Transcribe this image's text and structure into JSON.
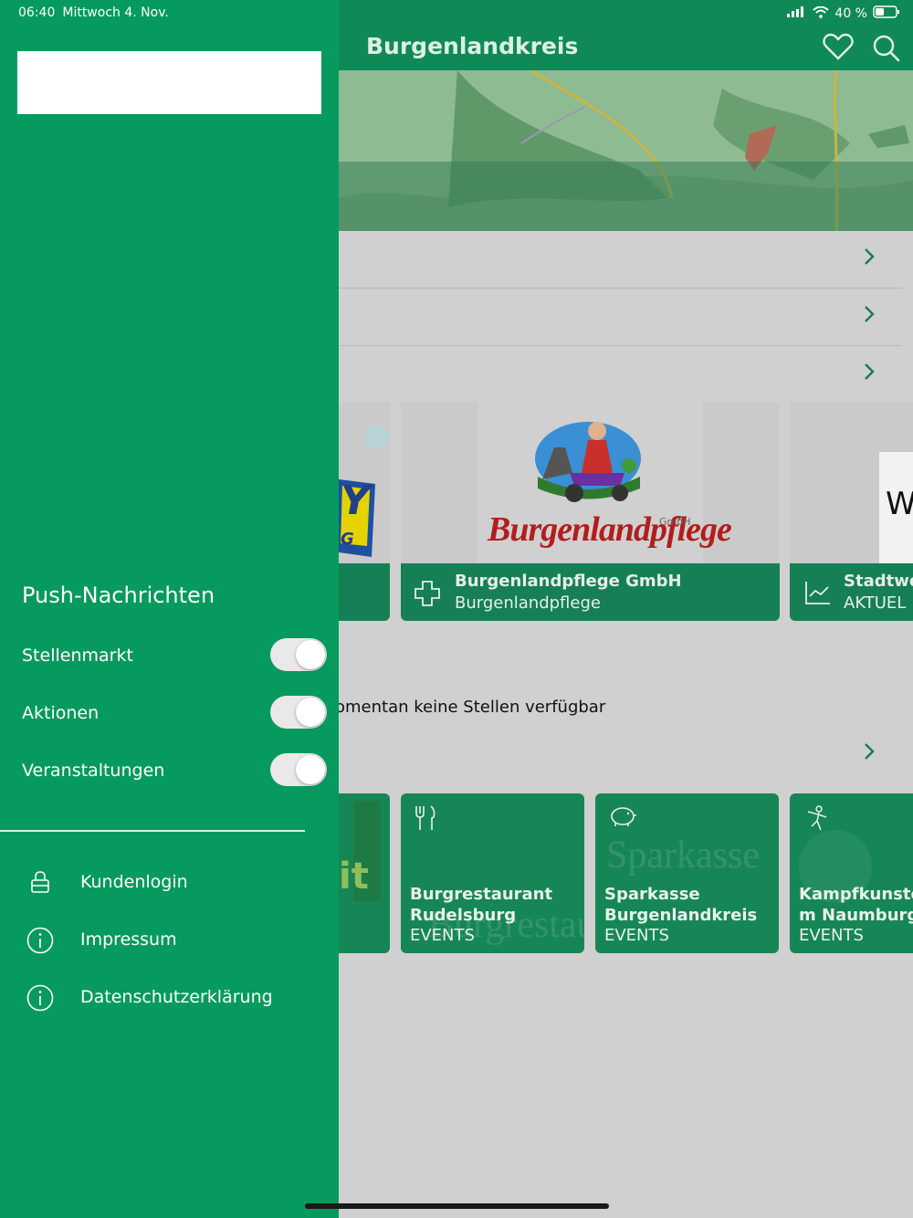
{
  "status": {
    "time": "06:40",
    "date": "Mittwoch 4. Nov.",
    "battery": "40 %"
  },
  "header": {
    "title": "Burgenlandkreis"
  },
  "sidebar": {
    "push_title": "Push-Nachrichten",
    "toggles": [
      {
        "label": "Stellenmarkt",
        "on": true
      },
      {
        "label": "Aktionen",
        "on": true
      },
      {
        "label": "Veranstaltungen",
        "on": true
      }
    ],
    "menu": [
      {
        "label": "Kundenlogin",
        "icon": "lock-icon"
      },
      {
        "label": "Impressum",
        "icon": "info-icon"
      },
      {
        "label": "Datenschutzerklärung",
        "icon": "info-icon"
      }
    ]
  },
  "main": {
    "partners": [
      {
        "name": "Burgenlandpflege GmbH",
        "sub": "Burgenlandpflege",
        "logo_text": "Burgenlandpflege",
        "logo_small": "GmbH",
        "icon": "plus-cross-icon"
      },
      {
        "name": "Stadtwe",
        "sub": "AKTUEL",
        "logo_text": "W",
        "icon": "chart-icon"
      }
    ],
    "partial_logo_text": "Y",
    "partial_logo_sub": "G",
    "jobs_message": "omentan keine Stellen verfügbar",
    "events": [
      {
        "name_line1": "Burgrestaurant",
        "name_line2": "Rudelsburg",
        "category": "EVENTS",
        "icon": "fork-knife-icon",
        "watermark": "Burgrestaurant"
      },
      {
        "name_line1": "Sparkasse",
        "name_line2": "Burgenlandkreis",
        "category": "EVENTS",
        "icon": "piggy-bank-icon",
        "watermark": "Sparkasse"
      },
      {
        "name_line1": "Kampfkunstc",
        "name_line2": "m Naumburg",
        "category": "EVENTS",
        "icon": "person-kick-icon",
        "watermark": ""
      }
    ],
    "partial_event_text": "it"
  },
  "colors": {
    "drawer": "#079a5e",
    "header": "#0f8a57",
    "card": "#178656"
  }
}
